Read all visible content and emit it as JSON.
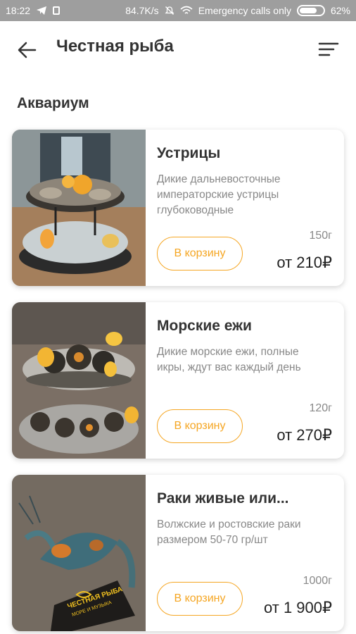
{
  "status_bar": {
    "time": "18:22",
    "network_speed": "84.7K/s",
    "carrier_text": "Emergency calls only",
    "battery_percent": "62%",
    "battery_level": 0.62
  },
  "app_bar": {
    "title": "Честная рыба",
    "back_icon": "arrow-left-icon",
    "filter_icon": "sort-lines-icon"
  },
  "section": {
    "title": "Аквариум"
  },
  "products": [
    {
      "name": "Устрицы",
      "description": "Дикие дальневосточные императорские устрицы глубоководные",
      "weight": "150г",
      "price": "от 210₽",
      "cart_label": "В корзину"
    },
    {
      "name": "Морские ежи",
      "description": "Дикие морские ежи, полные икры, ждут вас каждый день",
      "weight": "120г",
      "price": "от 270₽",
      "cart_label": "В корзину"
    },
    {
      "name": "Раки живые или...",
      "description": "Волжские и ростовские раки размером 50-70 гр/шт",
      "weight": "1000г",
      "price": "от 1 900₽",
      "cart_label": "В корзину",
      "photo_sign_line1": "ЧЕСТНАЯ РЫБА",
      "photo_sign_line2": "МОРЕ И МУЗЫКА"
    }
  ],
  "colors": {
    "accent": "#f5a623",
    "status_bar": "#9e9e9e",
    "text_primary": "#333333",
    "text_secondary": "#888888"
  }
}
